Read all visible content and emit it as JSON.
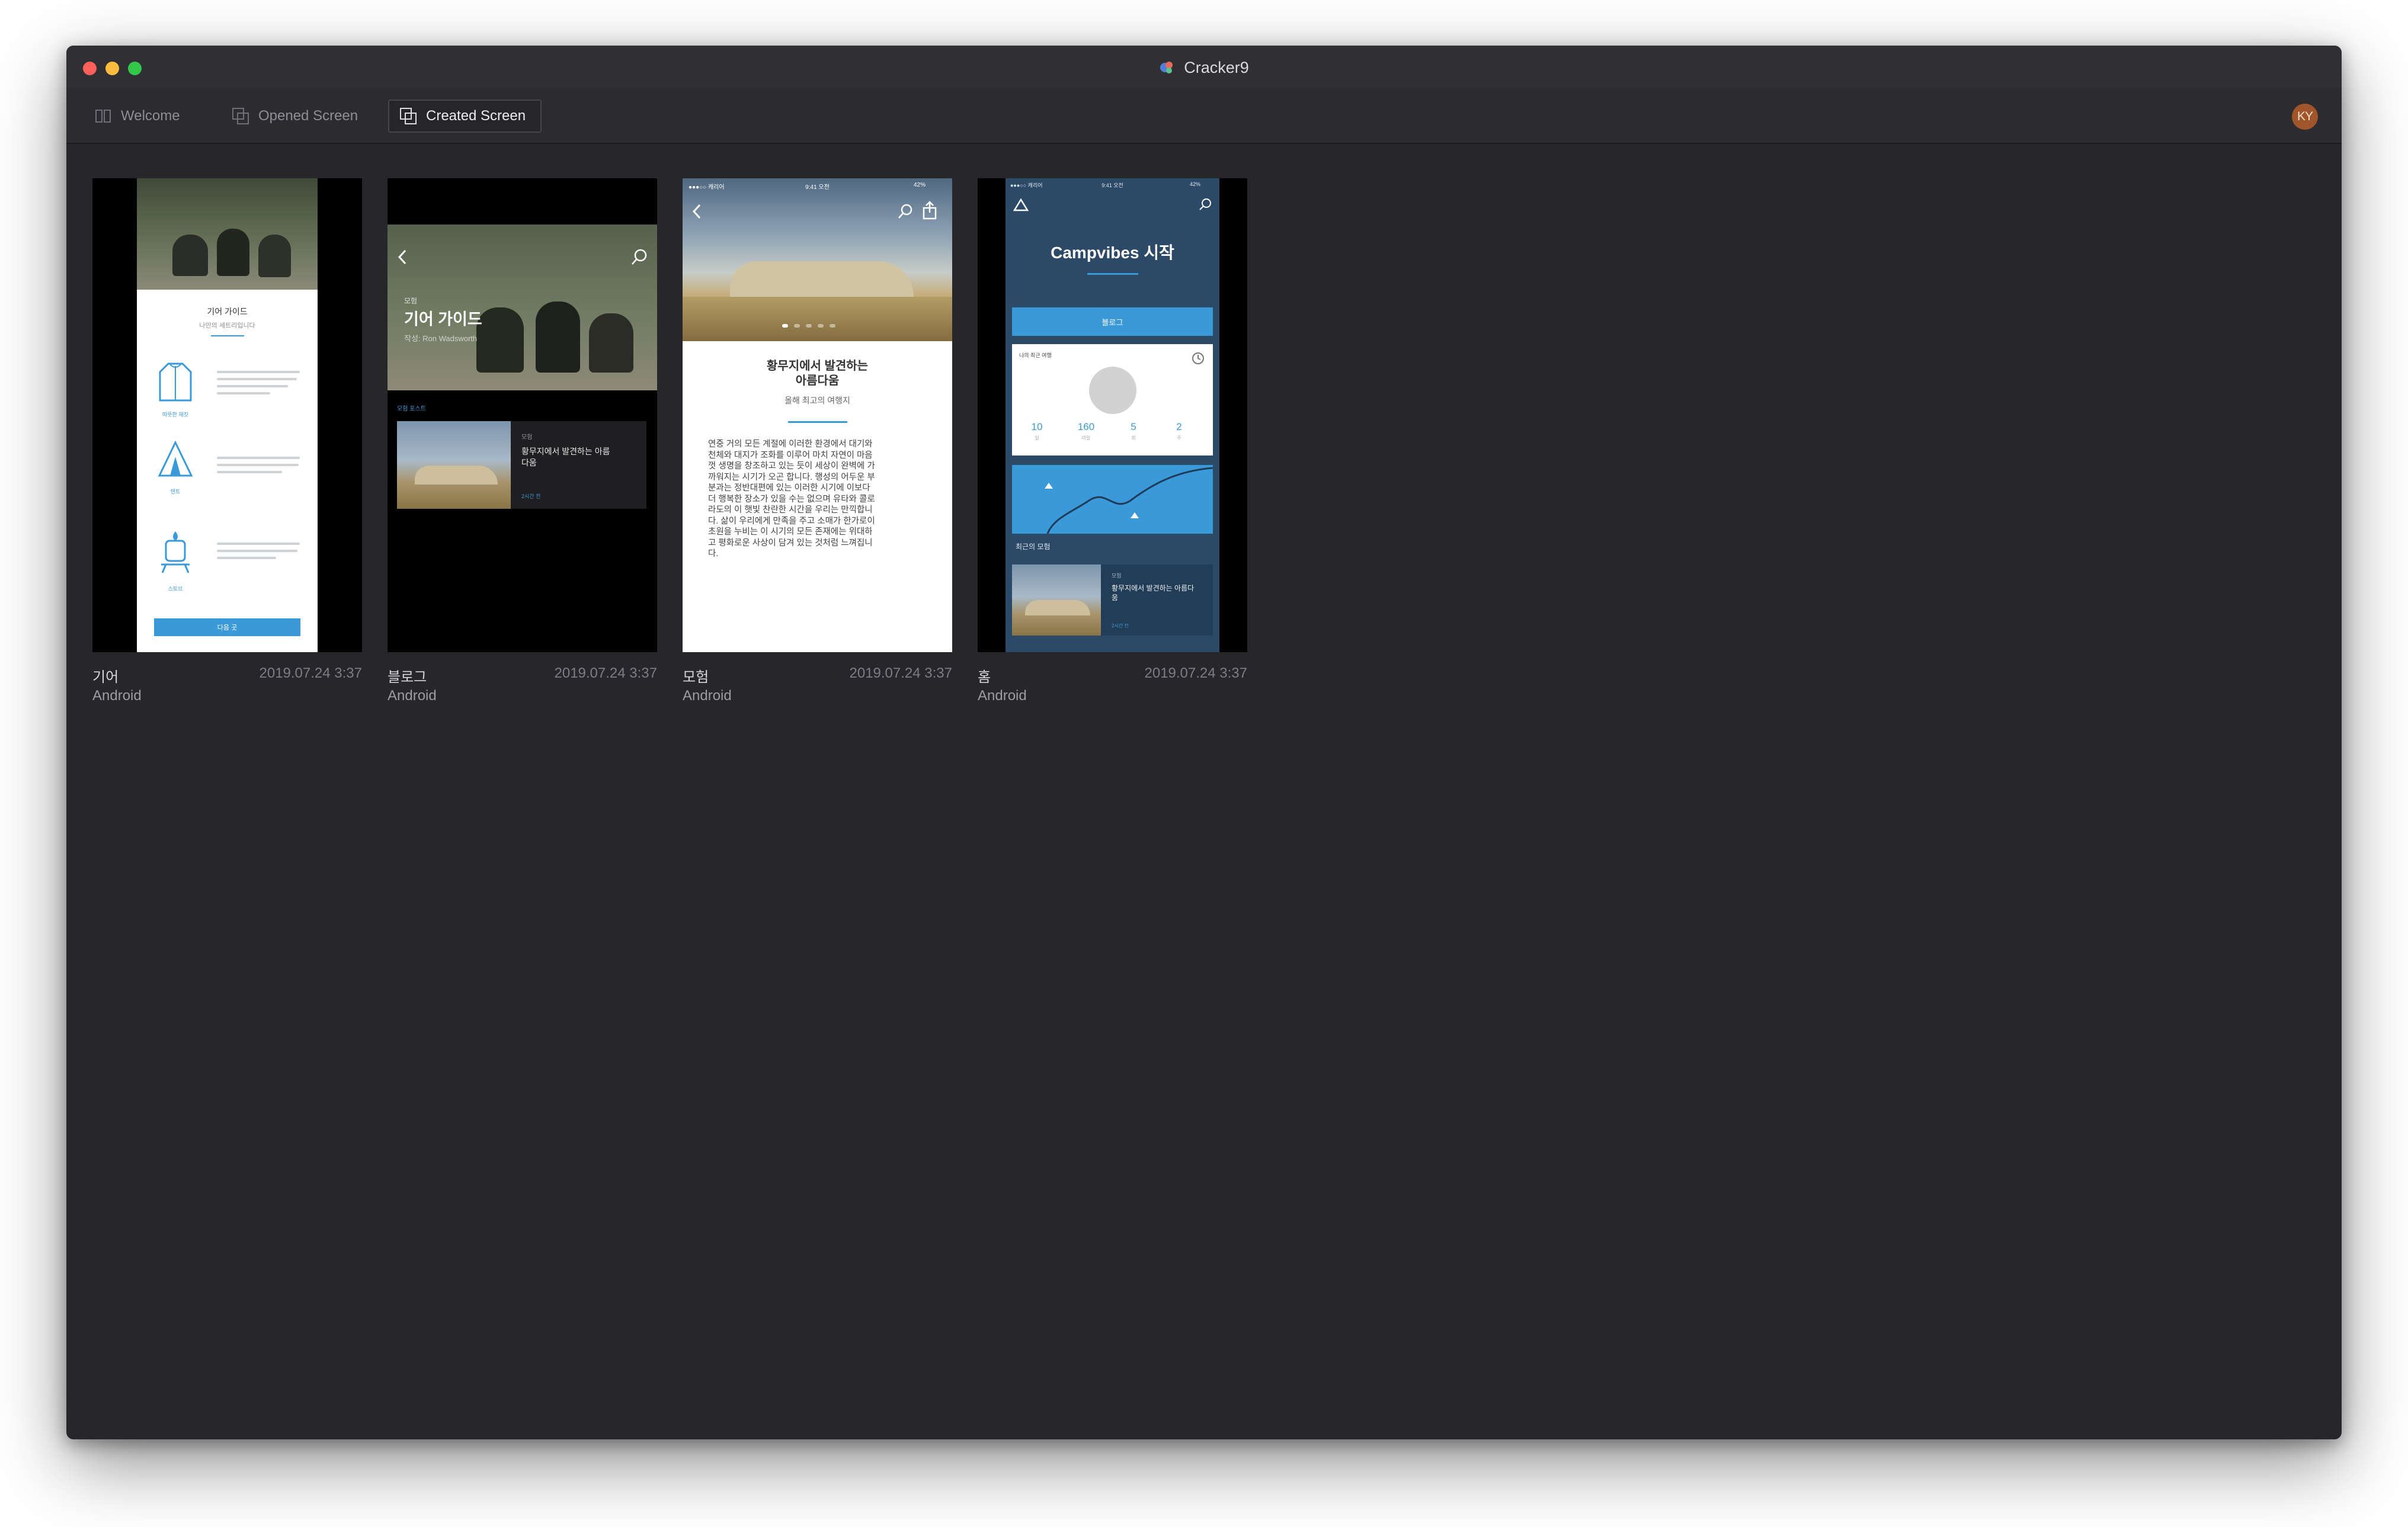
{
  "window": {
    "title": "Cracker9"
  },
  "tabs": [
    {
      "label": "Welcome",
      "active": false
    },
    {
      "label": "Opened Screen",
      "active": false
    },
    {
      "label": "Created Screen",
      "active": true
    }
  ],
  "user": {
    "initials": "KY"
  },
  "cards": [
    {
      "name": "기어",
      "date": "2019.07.24 3:37",
      "platform": "Android"
    },
    {
      "name": "블로그",
      "date": "2019.07.24 3:37",
      "platform": "Android"
    },
    {
      "name": "모험",
      "date": "2019.07.24 3:37",
      "platform": "Android"
    },
    {
      "name": "홈",
      "date": "2019.07.24 3:37",
      "platform": "Android"
    }
  ],
  "previews": {
    "gear": {
      "title": "기어 가이드",
      "subtitle": "나만의 세트리입니다",
      "items": [
        {
          "label": "따뜻한 재킷"
        },
        {
          "label": "텐트"
        },
        {
          "label": "스토브"
        }
      ],
      "button": "다음 곳"
    },
    "blog": {
      "category": "모험",
      "title": "기어 가이드",
      "author": "작성: Ron Wadsworth",
      "section": "모험 포스트",
      "post_category": "모험",
      "post_title": "황무지에서 발견하는 아름다움",
      "post_time": "2시간 전"
    },
    "adventure": {
      "status_carrier": "●●●○○ 캐리어",
      "status_time": "9:41 오전",
      "status_battery": "42%",
      "title_line1": "황무지에서 발견하는",
      "title_line2": "아름다움",
      "subtitle": "올해 최고의 여행지",
      "body": [
        "연중 거의 모든 계절에 이러한 환경에서 대기와",
        "천체와 대지가 조화를 이루어 마치 자연이 마음",
        "껏 생명을 창조하고 있는 듯이 세상이 완벽에 가",
        "까워지는 시기가 오곤 합니다. 행성의 어두운 부",
        "분과는 정반대편에 있는 이러한 시기에 이보다",
        "더 행복한 장소가 있을 수는 없으며 유타와 콜로",
        "라도의 이 햇빛 찬란한 시간을 우리는 만끽합니",
        "다. 삶이 우리에게 만족을 주고 소매가 한가로이",
        "초원을 누비는 이 시기의 모든 존재에는 위대하",
        "고 평화로운 사상이 담겨 있는 것처럼 느껴집니",
        "다."
      ]
    },
    "home": {
      "status_carrier": "●●●○○ 캐리어",
      "status_time": "9:41 오전",
      "status_battery": "42%",
      "title": "Campvibes 시작",
      "button": "블로그",
      "stats_header": "나의 최근 여행",
      "stats": [
        {
          "value": "10",
          "unit": "일"
        },
        {
          "value": "160",
          "unit": "마일"
        },
        {
          "value": "5",
          "unit": "회"
        },
        {
          "value": "2",
          "unit": "주"
        }
      ],
      "recent_label": "최근의 모험",
      "post_category": "모험",
      "post_title": "황무지에서 발견하는 아름다움",
      "post_time": "2시간 전"
    }
  },
  "colors": {
    "window_bg": "#26262b",
    "titlebar_bg": "#2f2f34",
    "accent_blue": "#3a9ad9",
    "home_bg": "#2c4a68",
    "avatar_bg": "#a0562a"
  }
}
